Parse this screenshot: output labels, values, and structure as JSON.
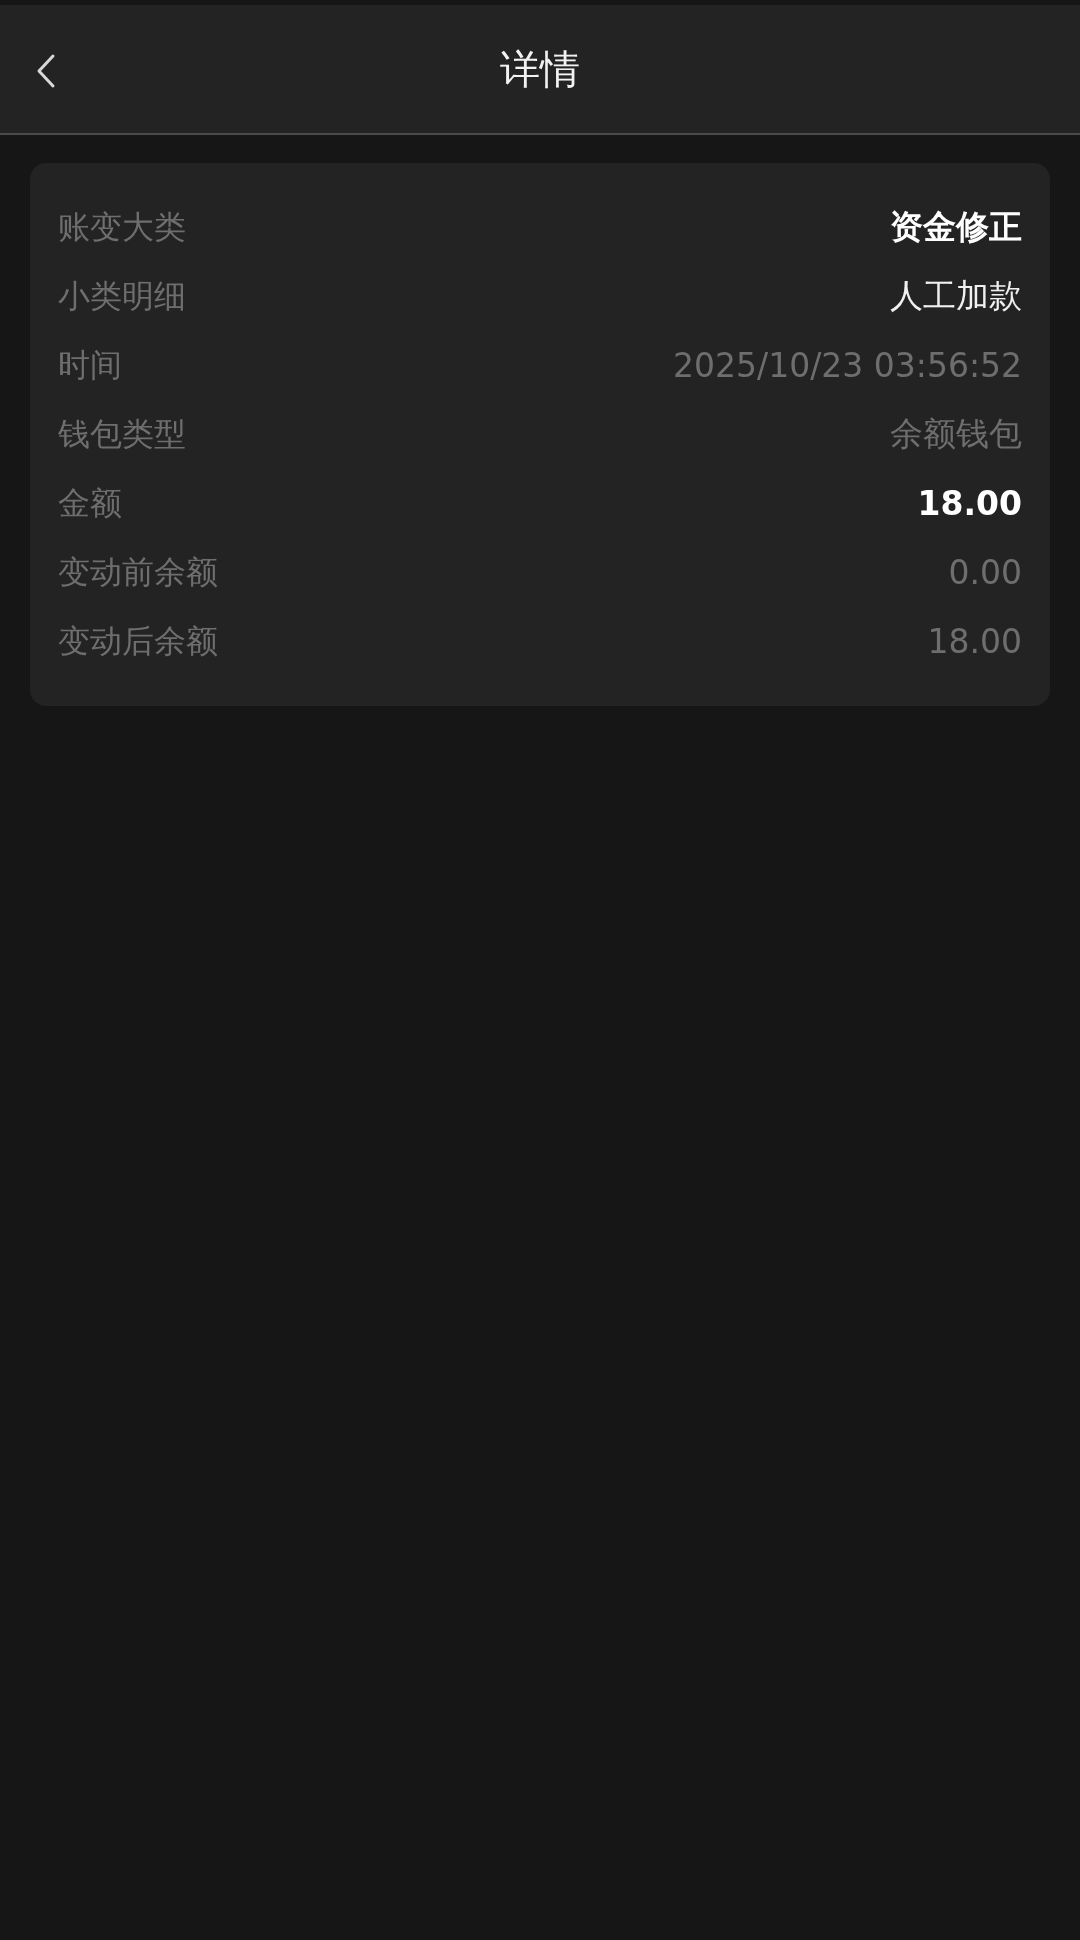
{
  "header": {
    "title": "详情"
  },
  "details": [
    {
      "label": "账变大类",
      "value": "资金修正",
      "kind": "strong"
    },
    {
      "label": "小类明细",
      "value": "人工加款",
      "kind": "normal"
    },
    {
      "label": "时间",
      "value": "2025/10/23 03:56:52",
      "kind": "muted"
    },
    {
      "label": "钱包类型",
      "value": "余额钱包",
      "kind": "muted"
    },
    {
      "label": "金额",
      "value": "18.00",
      "kind": "strong"
    },
    {
      "label": "变动前余额",
      "value": "0.00",
      "kind": "muted"
    },
    {
      "label": "变动后余额",
      "value": "18.00",
      "kind": "muted"
    }
  ]
}
